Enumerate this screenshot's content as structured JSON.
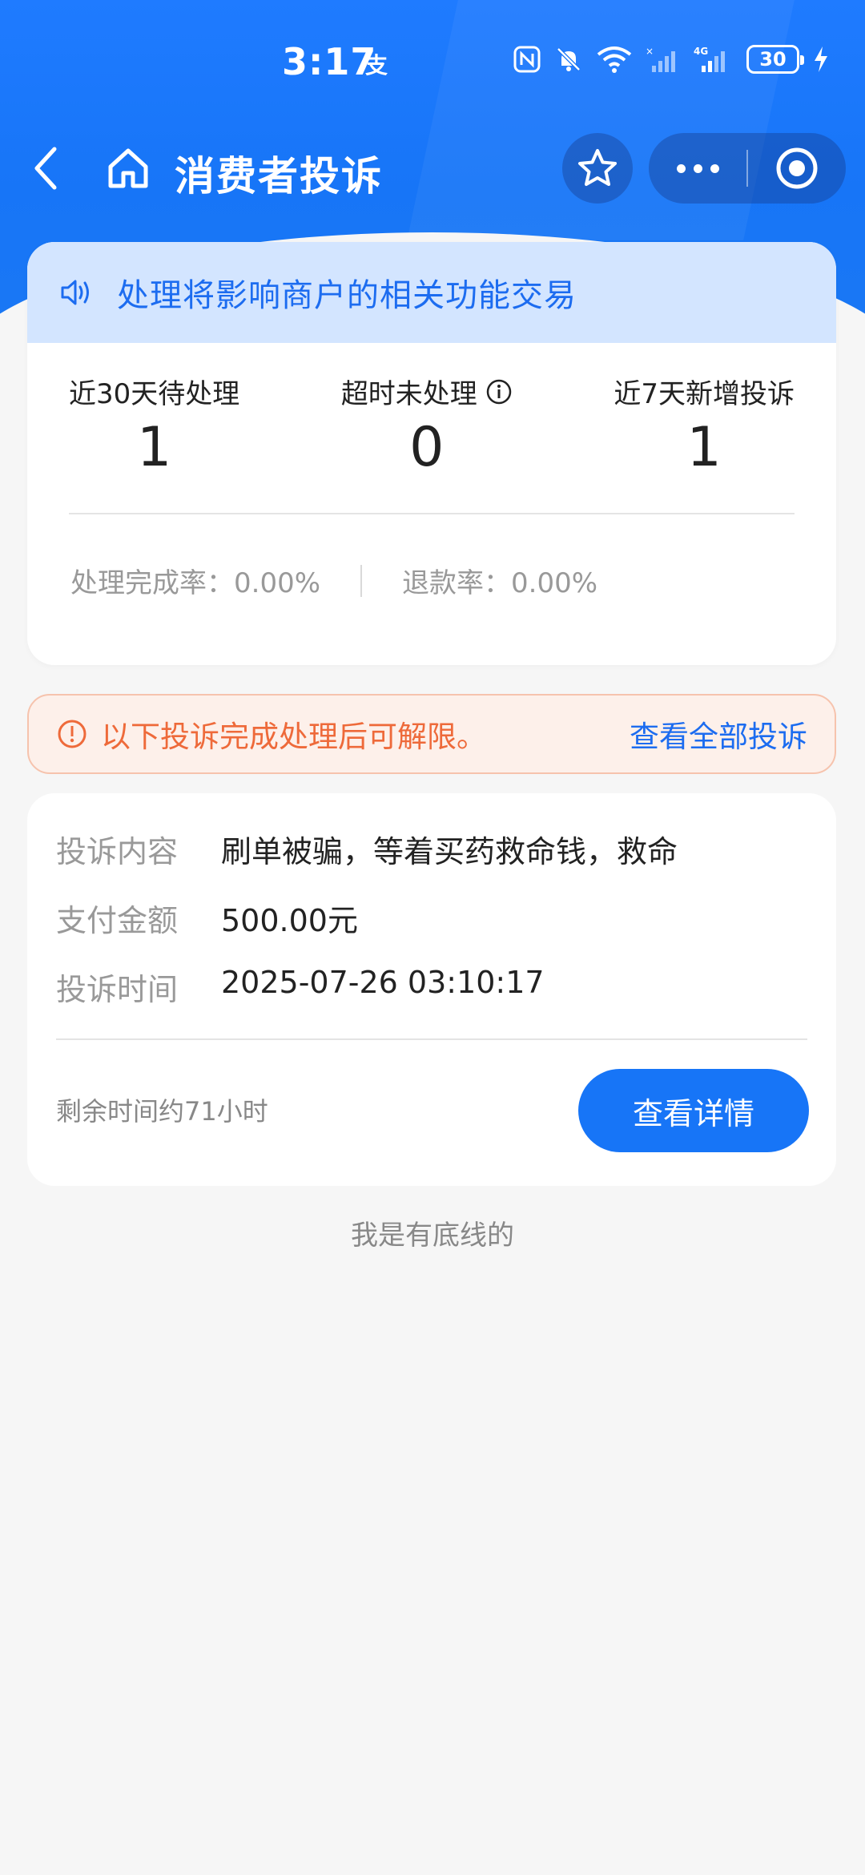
{
  "status_bar": {
    "time": "3:17",
    "app_glyph": "支",
    "battery": "30",
    "icons": [
      "nfc-icon",
      "mute-bell-icon",
      "wifi-icon",
      "signal-icon",
      "signal-4g-icon",
      "charging-icon"
    ]
  },
  "nav": {
    "title": "消费者投诉",
    "icons": [
      "back-arrow-icon",
      "home-icon",
      "star-icon",
      "more-dots-icon",
      "target-icon"
    ]
  },
  "notice": {
    "text": "处理将影响商户的相关功能交易",
    "icon": "speaker-icon"
  },
  "stats": [
    {
      "label": "近30天待处理",
      "value": "1"
    },
    {
      "label": "超时未处理",
      "value": "0",
      "info_icon": "info-icon"
    },
    {
      "label": "近7天新增投诉",
      "value": "1"
    }
  ],
  "rates": {
    "completion": "处理完成率：0.00%",
    "refund": "退款率：0.00%"
  },
  "warning": {
    "text": "以下投诉完成处理后可解限。",
    "link": "查看全部投诉",
    "icon": "alert-icon"
  },
  "complaint": {
    "content_label": "投诉内容",
    "content_value": "刷单被骗，等着买药救命钱，救命",
    "amount_label": "支付金额",
    "amount_value": "500.00元",
    "time_label": "投诉时间",
    "time_value": "2025-07-26 03:10:17",
    "remaining": "剩余时间约71小时",
    "detail_button": "查看详情"
  },
  "footer": "我是有底线的",
  "colors": {
    "brand_blue": "#1775f7",
    "notice_bg": "#d3e5ff",
    "warning_orange": "#ee6a3a",
    "warning_bg": "#fdf0ea"
  }
}
